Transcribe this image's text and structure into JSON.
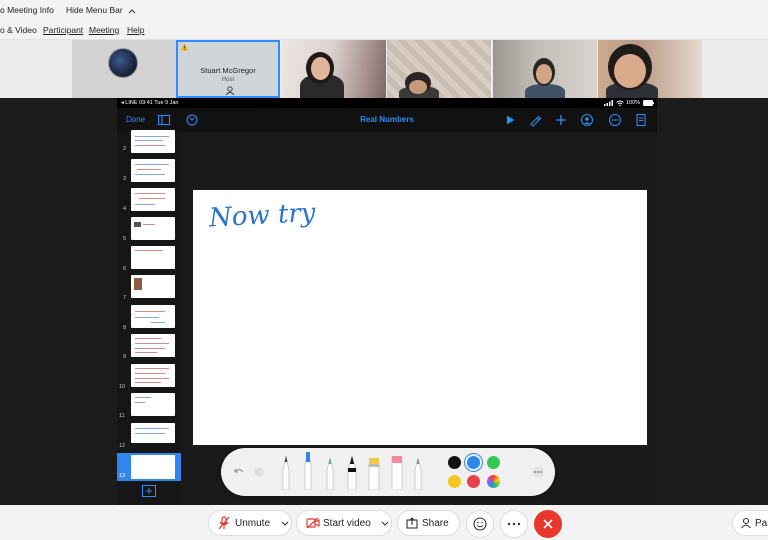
{
  "menubar": {
    "meeting_info": "o Meeting Info",
    "hide_menu_bar": "Hide Menu Bar",
    "items": [
      "o & Video",
      "Participant",
      "Meeting",
      "Help"
    ]
  },
  "participants": {
    "host_name": "Stuart McGregor",
    "host_role": "Host"
  },
  "ipad": {
    "status_left": "◂ LINE  09:41  Tue 9 Jan",
    "status_right": "100%",
    "done_label": "Done",
    "title": "Real Numbers",
    "slide_numbers": [
      "2",
      "3",
      "4",
      "5",
      "6",
      "7",
      "8",
      "9",
      "10",
      "11",
      "12",
      "13"
    ],
    "handwriting": "Now try",
    "pen_colors": [
      "#111111",
      "#2f86ee",
      "#34c759",
      "#f7c622",
      "#e9424a",
      "rainbow"
    ]
  },
  "controls": {
    "unmute_label": "Unmute",
    "start_video_label": "Start video",
    "share_label": "Share",
    "participants_label": "Par"
  },
  "colors": {
    "accent": "#2d8cff",
    "end": "#e8372c",
    "ipad_blue": "#2f8bf5"
  }
}
